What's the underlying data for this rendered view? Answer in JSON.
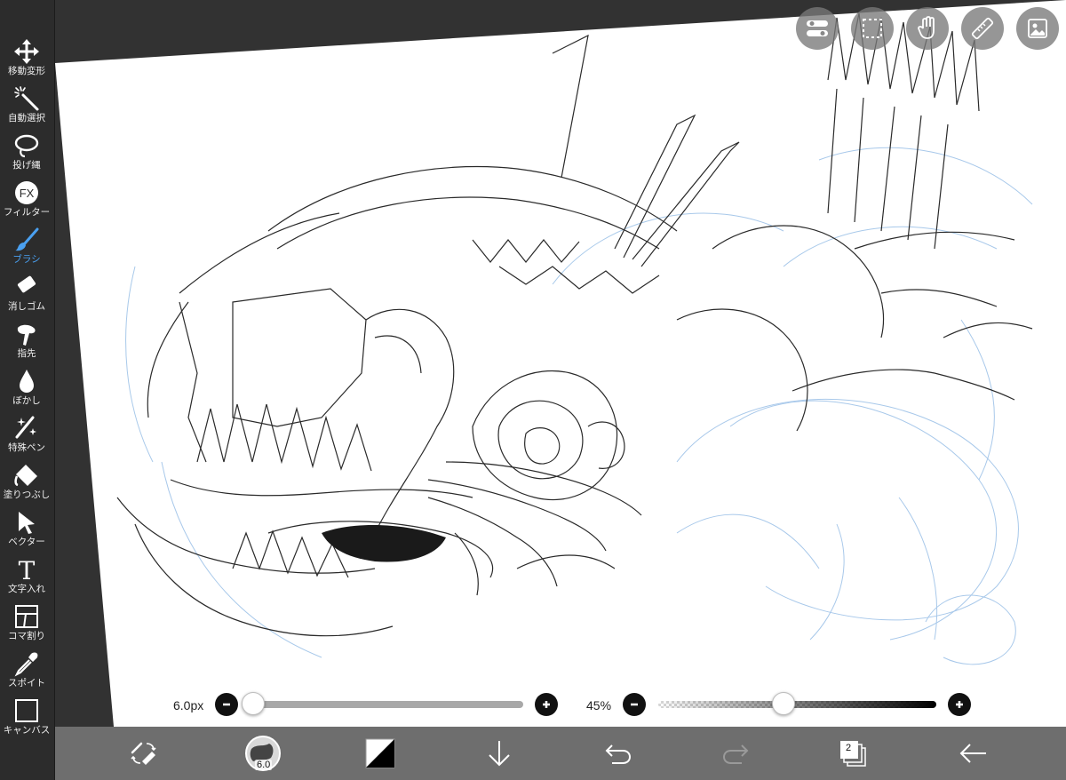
{
  "colors": {
    "toolbar_bg": "#2c2c2c",
    "active_tool": "#4aa0f0",
    "bottom_bar_bg": "#6e6e6e",
    "canvas": "#ffffff",
    "sketch_line": "#2a2a2a",
    "underdrawing_line": "#9fc3e8"
  },
  "tools": [
    {
      "label": "移動変形",
      "icon": "move-arrows-icon"
    },
    {
      "label": "自動選択",
      "icon": "magic-wand-icon"
    },
    {
      "label": "投げ縄",
      "icon": "lasso-icon"
    },
    {
      "label": "フィルター",
      "icon": "fx-icon",
      "icon_text": "FX"
    },
    {
      "label": "ブラシ",
      "icon": "brush-icon",
      "active": true
    },
    {
      "label": "消しゴム",
      "icon": "eraser-icon"
    },
    {
      "label": "指先",
      "icon": "finger-icon"
    },
    {
      "label": "ぼかし",
      "icon": "blur-drop-icon"
    },
    {
      "label": "特殊ペン",
      "icon": "sparkle-pen-icon"
    },
    {
      "label": "塗りつぶし",
      "icon": "fill-bucket-icon"
    },
    {
      "label": "ベクター",
      "icon": "vector-cursor-icon"
    },
    {
      "label": "文字入れ",
      "icon": "text-icon",
      "icon_text": "T"
    },
    {
      "label": "コマ割り",
      "icon": "frame-divider-icon"
    },
    {
      "label": "スポイト",
      "icon": "eyedropper-icon"
    },
    {
      "label": "キャンバス",
      "icon": "canvas-icon"
    }
  ],
  "top_buttons": [
    "toggle-icon",
    "selection-icon",
    "hand-icon",
    "ruler-icon",
    "reference-icon"
  ],
  "brush_size": {
    "label": "6.0px",
    "fraction": 0.0
  },
  "brush_opacity": {
    "label": "45%",
    "fraction": 0.45
  },
  "bottom_bar": {
    "brush_size_value": "6.0",
    "layer_count": "2",
    "icons": [
      "swap-brush-eraser-icon",
      "brush-preview-icon",
      "color-swatch-icon",
      "download-arrow-icon",
      "undo-icon",
      "redo-icon",
      "layers-icon",
      "back-arrow-icon"
    ]
  }
}
